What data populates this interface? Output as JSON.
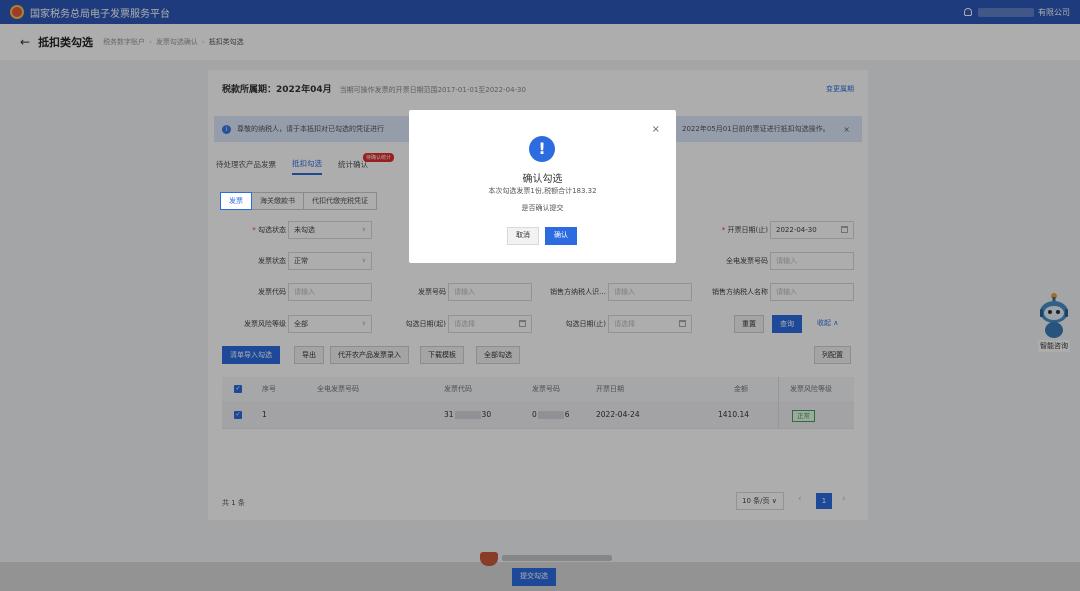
{
  "header": {
    "app_title": "国家税务总局电子发票服务平台",
    "company_suffix": "有限公司"
  },
  "subheader": {
    "back_icon": "←",
    "page_title": "抵扣类勾选",
    "breadcrumbs": [
      "税务数字账户",
      "发票勾选确认",
      "抵扣类勾选"
    ]
  },
  "period": {
    "label": "税款所属期：",
    "value": "2022年04月",
    "note": "当期可操作发票的开票日期范围2017-01-01至2022-04-30",
    "switch_label": "变更属期"
  },
  "notice": {
    "text": "尊敬的纳税人，请于本抵扣对已勾选的凭证进行",
    "text_right": "2022年05月01日前的票证进行抵扣勾选操作。",
    "close": "×"
  },
  "tabs": [
    {
      "label": "待处理农产品发票"
    },
    {
      "label": "抵扣勾选"
    },
    {
      "label": "统计确认",
      "badge": "待确认统计"
    }
  ],
  "subtabs": [
    "发票",
    "海关缴款书",
    "代扣代缴完税凭证"
  ],
  "filters": {
    "check_status_label": "勾选状态",
    "check_status_value": "未勾选",
    "invoice_date_end_label": "开票日期(止)",
    "invoice_date_end_value": "2022-04-30",
    "invoice_status_label": "发票状态",
    "invoice_status_value": "正常",
    "digital_invoice_no_label": "全电发票号码",
    "invoice_code_label": "发票代码",
    "invoice_no_label": "发票号码",
    "seller_tax_id_label": "销售方纳税人识…",
    "seller_name_label": "销售方纳税人名称",
    "risk_level_label": "发票风险等级",
    "risk_level_value": "全部",
    "check_date_start_label": "勾选日期(起)",
    "check_date_end_label": "勾选日期(止)",
    "placeholder_input": "请输入",
    "placeholder_select": "请选择",
    "reset": "重置",
    "search": "查询",
    "collapse": "收起 ∧"
  },
  "toolbar": {
    "import_btn": "清单导入勾选",
    "export_btn": "导出",
    "agri_btn": "代开农产品发票录入",
    "template_btn": "下载模板",
    "select_all_btn": "全部勾选",
    "columns_btn": "列配置"
  },
  "table": {
    "headers": [
      "序号",
      "全电发票号码",
      "发票代码",
      "发票号码",
      "开票日期",
      "金额",
      "发票风险等级"
    ],
    "rows": [
      {
        "index": "1",
        "code_start": "31",
        "code_end": "30",
        "no_start": "0",
        "no_end": "6",
        "date": "2022-04-24",
        "amount": "1410.14",
        "risk": "正常"
      }
    ]
  },
  "footer": {
    "total": "共 1 条",
    "page_size": "10 条/页 ∨",
    "current_page": "1",
    "submit": "提交勾选"
  },
  "assistant": {
    "label": "智能咨询"
  },
  "modal": {
    "close": "×",
    "icon": "!",
    "title": "确认勾选",
    "message": "本次勾选发票1份,税额合计183.32",
    "question": "是否确认提交",
    "cancel": "取消",
    "confirm": "确认"
  }
}
